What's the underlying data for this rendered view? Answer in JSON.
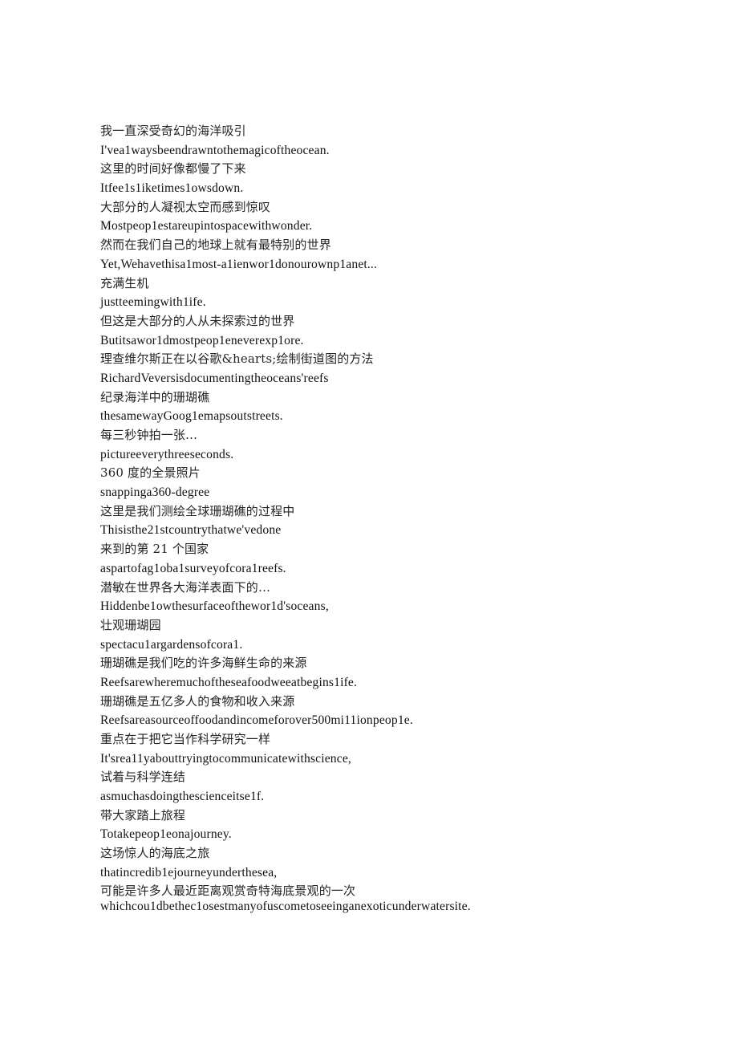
{
  "document": {
    "background_color": "#ffffff",
    "text_color": "#1a1a1a",
    "lines": [
      {
        "lang": "zh",
        "text": "我一直深受奇幻的海洋吸引"
      },
      {
        "lang": "en",
        "text": "I'vea1waysbeendrawntothemagicoftheocean."
      },
      {
        "lang": "zh",
        "text": "这里的时间好像都慢了下来"
      },
      {
        "lang": "en",
        "text": "Itfee1s1iketimes1owsdown."
      },
      {
        "lang": "zh",
        "text": "大部分的人凝视太空而感到惊叹"
      },
      {
        "lang": "en",
        "text": "Mostpeop1estareupintospacewithwonder."
      },
      {
        "lang": "zh",
        "text": "然而在我们自己的地球上就有最特别的世界"
      },
      {
        "lang": "en",
        "text": "Yet,Wehavethisa1most-a1ienwor1donourownp1anet..."
      },
      {
        "lang": "zh",
        "text": "充满生机"
      },
      {
        "lang": "en",
        "text": "justteemingwith1ife."
      },
      {
        "lang": "zh",
        "text": "但这是大部分的人从未探索过的世界"
      },
      {
        "lang": "en",
        "text": "Butitsawor1dmostpeop1eneverexp1ore."
      },
      {
        "lang": "zh",
        "text": "理查维尔斯正在以谷歌&hearts;绘制街道图的方法"
      },
      {
        "lang": "en",
        "text": "RichardVeversisdocumentingtheoceans'reefs"
      },
      {
        "lang": "zh",
        "text": "纪录海洋中的珊瑚礁"
      },
      {
        "lang": "en",
        "text": "thesamewayGoog1emapsoutstreets."
      },
      {
        "lang": "zh",
        "text": "每三秒钟拍一张…"
      },
      {
        "lang": "en",
        "text": "pictureeverythreeseconds."
      },
      {
        "lang": "zh",
        "text": "360 度的全景照片"
      },
      {
        "lang": "en",
        "text": "snappinga360-degree"
      },
      {
        "lang": "zh",
        "text": "这里是我们测绘全球珊瑚礁的过程中"
      },
      {
        "lang": "en",
        "text": "Thisisthe21stcountrythatwe'vedone"
      },
      {
        "lang": "zh",
        "text": "来到的第 21 个国家"
      },
      {
        "lang": "en",
        "text": "aspartofag1oba1surveyofcora1reefs."
      },
      {
        "lang": "zh",
        "text": "潜敏在世界各大海洋表面下的…"
      },
      {
        "lang": "en",
        "text": "Hiddenbe1owthesurfaceofthewor1d'soceans,"
      },
      {
        "lang": "zh",
        "text": "壮观珊瑚园"
      },
      {
        "lang": "en",
        "text": "spectacu1argardensofcora1."
      },
      {
        "lang": "zh",
        "text": "珊瑚礁是我们吃的许多海鲜生命的来源"
      },
      {
        "lang": "en",
        "text": "Reefsarewheremuchoftheseafoodweeatbegins1ife."
      },
      {
        "lang": "zh",
        "text": "珊瑚礁是五亿多人的食物和收入来源"
      },
      {
        "lang": "en",
        "text": "Reefsareasourceoffoodandincomeforover500mi11ionpeop1e."
      },
      {
        "lang": "zh",
        "text": "重点在于把它当作科学研究一样"
      },
      {
        "lang": "en",
        "text": "It'srea11yabouttryingtocommunicatewithscience,"
      },
      {
        "lang": "zh",
        "text": "试着与科学连结"
      },
      {
        "lang": "en",
        "text": "asmuchasdoingthescienceitse1f."
      },
      {
        "lang": "zh",
        "text": "带大家踏上旅程"
      },
      {
        "lang": "en",
        "text": "Totakepeop1eonajourney."
      },
      {
        "lang": "zh",
        "text": "这场惊人的海底之旅"
      },
      {
        "lang": "en",
        "text": "thatincredib1ejourneyunderthesea,"
      },
      {
        "lang": "zh",
        "text": "可能是许多人最近距离观赏奇特海底景观的一次",
        "tight": true
      },
      {
        "lang": "en",
        "text": "whichcou1dbethec1osestmanyofuscometoseeinganexoticunderwatersite.",
        "tight": true
      }
    ]
  }
}
